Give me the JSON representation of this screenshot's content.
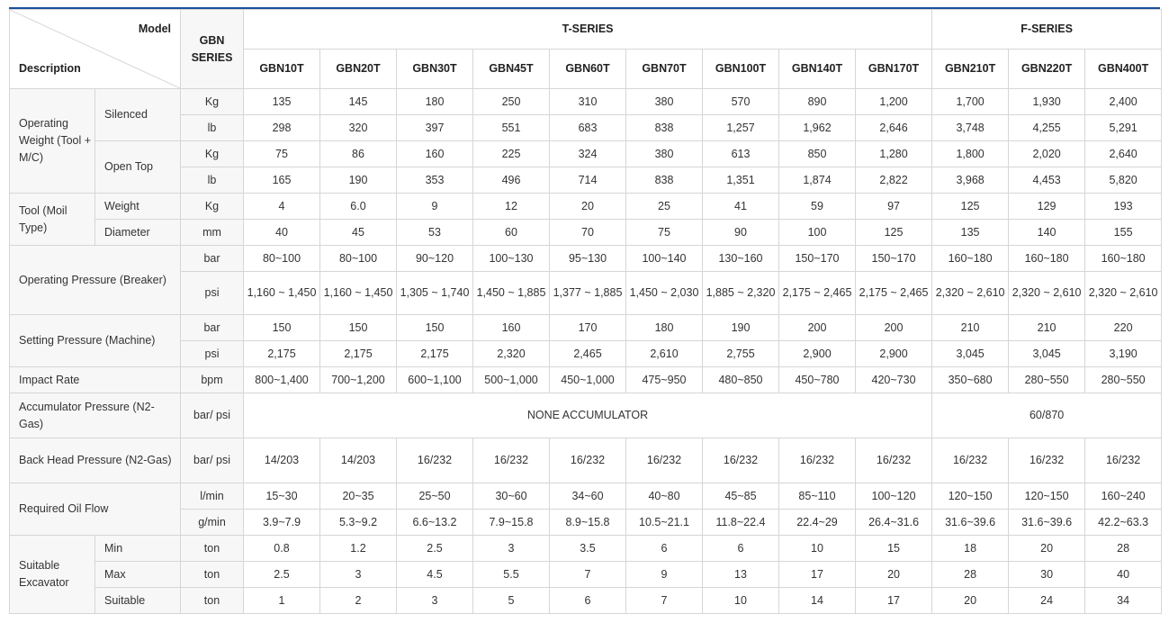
{
  "header": {
    "corner_model": "Model",
    "corner_description": "Description",
    "gbn_series": "GBN SERIES",
    "t_series": "T-SERIES",
    "f_series": "F-SERIES",
    "models": [
      "GBN10T",
      "GBN20T",
      "GBN30T",
      "GBN45T",
      "GBN60T",
      "GBN70T",
      "GBN100T",
      "GBN140T",
      "GBN170T",
      "GBN210T",
      "GBN220T",
      "GBN400T"
    ]
  },
  "groups": {
    "operating_weight": "Operating Weight (Tool + M/C)",
    "silenced": "Silenced",
    "open_top": "Open Top",
    "tool": "Tool (Moil Type)",
    "weight": "Weight",
    "diameter": "Diameter",
    "operating_pressure": "Operating Pressure (Breaker)",
    "setting_pressure": "Setting Pressure (Machine)",
    "impact_rate": "Impact Rate",
    "accumulator_pressure": "Accumulator Pressure (N2-Gas)",
    "back_head_pressure": "Back Head Pressure (N2-Gas)",
    "required_oil_flow": "Required Oil Flow",
    "suitable_excavator": "Suitable Excavator",
    "min": "Min",
    "max": "Max",
    "suitable": "Suitable"
  },
  "rows": {
    "silenced_kg": {
      "unit": "Kg",
      "values": [
        "135",
        "145",
        "180",
        "250",
        "310",
        "380",
        "570",
        "890",
        "1,200",
        "1,700",
        "1,930",
        "2,400"
      ]
    },
    "silenced_lb": {
      "unit": "lb",
      "values": [
        "298",
        "320",
        "397",
        "551",
        "683",
        "838",
        "1,257",
        "1,962",
        "2,646",
        "3,748",
        "4,255",
        "5,291"
      ]
    },
    "opentop_kg": {
      "unit": "Kg",
      "values": [
        "75",
        "86",
        "160",
        "225",
        "324",
        "380",
        "613",
        "850",
        "1,280",
        "1,800",
        "2,020",
        "2,640"
      ]
    },
    "opentop_lb": {
      "unit": "lb",
      "values": [
        "165",
        "190",
        "353",
        "496",
        "714",
        "838",
        "1,351",
        "1,874",
        "2,822",
        "3,968",
        "4,453",
        "5,820"
      ]
    },
    "tool_weight": {
      "unit": "Kg",
      "values": [
        "4",
        "6.0",
        "9",
        "12",
        "20",
        "25",
        "41",
        "59",
        "97",
        "125",
        "129",
        "193"
      ]
    },
    "tool_diameter": {
      "unit": "mm",
      "values": [
        "40",
        "45",
        "53",
        "60",
        "70",
        "75",
        "90",
        "100",
        "125",
        "135",
        "140",
        "155"
      ]
    },
    "op_bar": {
      "unit": "bar",
      "values": [
        "80~100",
        "80~100",
        "90~120",
        "100~130",
        "95~130",
        "100~140",
        "130~160",
        "150~170",
        "150~170",
        "160~180",
        "160~180",
        "160~180"
      ]
    },
    "op_psi": {
      "unit": "psi",
      "values": [
        "1,160 ~ 1,450",
        "1,160 ~ 1,450",
        "1,305 ~ 1,740",
        "1,450 ~ 1,885",
        "1,377 ~ 1,885",
        "1,450 ~ 2,030",
        "1,885 ~ 2,320",
        "2,175 ~ 2,465",
        "2,175 ~ 2,465",
        "2,320 ~ 2,610",
        "2,320 ~ 2,610",
        "2,320 ~ 2,610"
      ]
    },
    "set_bar": {
      "unit": "bar",
      "values": [
        "150",
        "150",
        "150",
        "160",
        "170",
        "180",
        "190",
        "200",
        "200",
        "210",
        "210",
        "220"
      ]
    },
    "set_psi": {
      "unit": "psi",
      "values": [
        "2,175",
        "2,175",
        "2,175",
        "2,320",
        "2,465",
        "2,610",
        "2,755",
        "2,900",
        "2,900",
        "3,045",
        "3,045",
        "3,190"
      ]
    },
    "impact": {
      "unit": "bpm",
      "values": [
        "800~1,400",
        "700~1,200",
        "600~1,100",
        "500~1,000",
        "450~1,000",
        "475~950",
        "480~850",
        "450~780",
        "420~730",
        "350~680",
        "280~550",
        "280~550"
      ]
    },
    "accumulator": {
      "unit": "bar/ psi",
      "t_value": "NONE ACCUMULATOR",
      "f_value": "60/870"
    },
    "back_head": {
      "unit": "bar/ psi",
      "values": [
        "14/203",
        "14/203",
        "16/232",
        "16/232",
        "16/232",
        "16/232",
        "16/232",
        "16/232",
        "16/232",
        "16/232",
        "16/232",
        "16/232"
      ]
    },
    "oil_lmin": {
      "unit": "l/min",
      "values": [
        "15~30",
        "20~35",
        "25~50",
        "30~60",
        "34~60",
        "40~80",
        "45~85",
        "85~110",
        "100~120",
        "120~150",
        "120~150",
        "160~240"
      ]
    },
    "oil_gmin": {
      "unit": "g/min",
      "values": [
        "3.9~7.9",
        "5.3~9.2",
        "6.6~13.2",
        "7.9~15.8",
        "8.9~15.8",
        "10.5~21.1",
        "11.8~22.4",
        "22.4~29",
        "26.4~31.6",
        "31.6~39.6",
        "31.6~39.6",
        "42.2~63.3"
      ]
    },
    "exc_min": {
      "unit": "ton",
      "values": [
        "0.8",
        "1.2",
        "2.5",
        "3",
        "3.5",
        "6",
        "6",
        "10",
        "15",
        "18",
        "20",
        "28"
      ]
    },
    "exc_max": {
      "unit": "ton",
      "values": [
        "2.5",
        "3",
        "4.5",
        "5.5",
        "7",
        "9",
        "13",
        "17",
        "20",
        "28",
        "30",
        "40"
      ]
    },
    "exc_suitable": {
      "unit": "ton",
      "values": [
        "1",
        "2",
        "3",
        "5",
        "6",
        "7",
        "10",
        "14",
        "17",
        "20",
        "24",
        "34"
      ]
    }
  }
}
